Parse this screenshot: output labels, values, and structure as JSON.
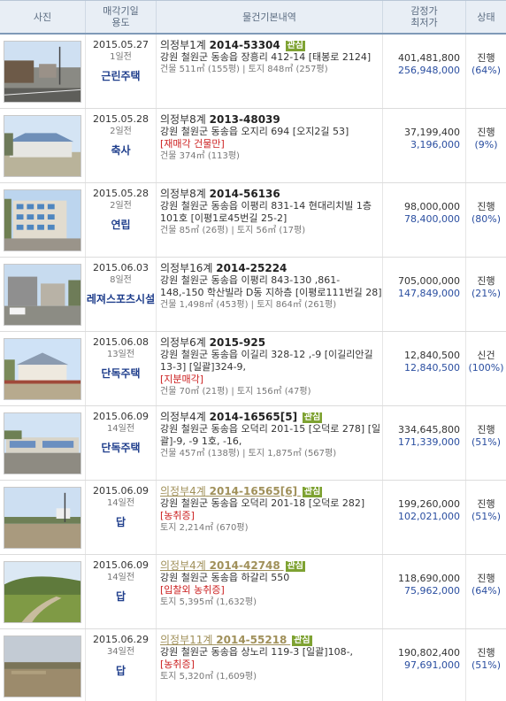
{
  "header": {
    "photo": "사진",
    "date_use_1": "매각기일",
    "date_use_2": "용도",
    "info": "물건기본내역",
    "price_1": "감정가",
    "price_2": "최저가",
    "status": "상태"
  },
  "rows": [
    {
      "date": "2015.05.27",
      "ago": "1일전",
      "use": "근린주택",
      "court": "의정부1계",
      "case_no": "2014-53304",
      "tag": "관심",
      "addr": "강원 철원군 동송읍 장흥리 412-14 [태봉로 2124]",
      "note": "",
      "area": "건물 511㎡ (155평) | 토지 848㎡ (257평)",
      "appraisal": "401,481,800",
      "minimum": "256,948,000",
      "status": "진행",
      "rate": "(64%)"
    },
    {
      "date": "2015.05.28",
      "ago": "2일전",
      "use": "축사",
      "court": "의정부8계",
      "case_no": "2013-48039",
      "tag": "",
      "addr": "강원 철원군 동송읍 오지리 694 [오지2길 53]",
      "note": "[재매각 건물만]",
      "area": "건물 374㎡ (113평)",
      "appraisal": "37,199,400",
      "minimum": "3,196,000",
      "status": "진행",
      "rate": "(9%)"
    },
    {
      "date": "2015.05.28",
      "ago": "2일전",
      "use": "연립",
      "court": "의정부8계",
      "case_no": "2014-56136",
      "tag": "",
      "addr": "강원 철원군 동송읍 이평리 831-14 현대리치빌 1층 101호 [이평1로45번길 25-2]",
      "note": "",
      "area": "건물 85㎡ (26평) | 토지 56㎡ (17평)",
      "appraisal": "98,000,000",
      "minimum": "78,400,000",
      "status": "진행",
      "rate": "(80%)"
    },
    {
      "date": "2015.06.03",
      "ago": "8일전",
      "use": "레져스포츠시설",
      "court": "의정부16계",
      "case_no": "2014-25224",
      "tag": "",
      "addr": "강원 철원군 동송읍 이평리 843-130 ,861-148,-150 학산빌라 D동 지하층 [이평로111번길 28]",
      "note": "",
      "area": "건물 1,498㎡ (453평) | 토지 864㎡ (261평)",
      "appraisal": "705,000,000",
      "minimum": "147,849,000",
      "status": "진행",
      "rate": "(21%)"
    },
    {
      "date": "2015.06.08",
      "ago": "13일전",
      "use": "단독주택",
      "court": "의정부6계",
      "case_no": "2015-925",
      "tag": "",
      "addr": "강원 철원군 동송읍 이길리 328-12 ,-9 [이길리안길 13-3] [일괄]324-9,",
      "note": "[지분매각]",
      "area": "건물 70㎡ (21평) | 토지 156㎡ (47평)",
      "appraisal": "12,840,500",
      "minimum": "12,840,500",
      "status": "신건",
      "rate": "(100%)"
    },
    {
      "date": "2015.06.09",
      "ago": "14일전",
      "use": "단독주택",
      "court": "의정부4계",
      "case_no": "2014-16565[5]",
      "tag": "관심",
      "addr": "강원 철원군 동송읍 오덕리 201-15 [오덕로 278] [일괄]-9, -9 1호, -16,",
      "note": "",
      "area": "건물 457㎡ (138평) | 토지 1,875㎡ (567평)",
      "appraisal": "334,645,800",
      "minimum": "171,339,000",
      "status": "진행",
      "rate": "(51%)"
    },
    {
      "date": "2015.06.09",
      "ago": "14일전",
      "use": "답",
      "court": "의정부4계",
      "case_no": "2014-16565[6]",
      "tag": "관심",
      "addr": "강원 철원군 동송읍 오덕리 201-18 [오덕로 282]",
      "note": "[농취증]",
      "area": "토지 2,214㎡ (670평)",
      "appraisal": "199,260,000",
      "minimum": "102,021,000",
      "status": "진행",
      "rate": "(51%)"
    },
    {
      "date": "2015.06.09",
      "ago": "14일전",
      "use": "답",
      "court": "의정부4계",
      "case_no": "2014-42748",
      "tag": "관심",
      "addr": "강원 철원군 동송읍 하갈리 550",
      "note": "[입찰외 농취증]",
      "area": "토지 5,395㎡ (1,632평)",
      "appraisal": "118,690,000",
      "minimum": "75,962,000",
      "status": "진행",
      "rate": "(64%)"
    },
    {
      "date": "2015.06.29",
      "ago": "34일전",
      "use": "답",
      "court": "의정부11계",
      "case_no": "2014-55218",
      "tag": "관심",
      "addr": "강원 철원군 동송읍 상노리 119-3 [일괄]108-,",
      "note": "[농취증]",
      "area": "토지 5,320㎡ (1,609평)",
      "appraisal": "190,802,400",
      "minimum": "97,691,000",
      "status": "진행",
      "rate": "(51%)"
    }
  ]
}
